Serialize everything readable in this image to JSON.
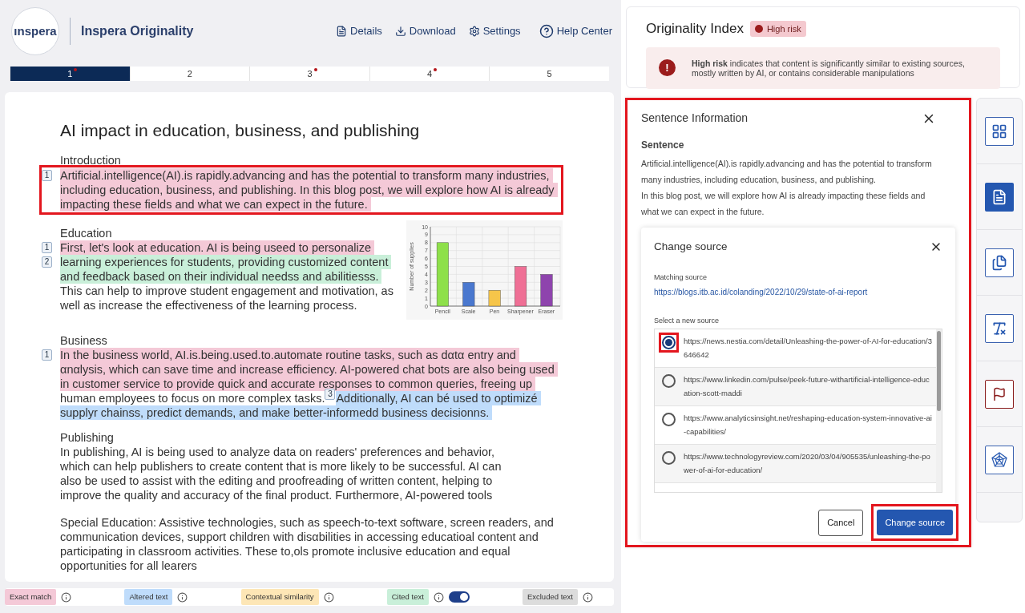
{
  "header": {
    "logo": "ınspera",
    "title": "Inspera Originality",
    "nav": [
      {
        "kind": "details",
        "label": "Details"
      },
      {
        "kind": "download",
        "label": "Download"
      },
      {
        "kind": "settings",
        "label": "Settings"
      },
      {
        "kind": "help",
        "label": "Help Center"
      }
    ]
  },
  "pages": [
    {
      "label": "1",
      "selected": true,
      "flagged": true
    },
    {
      "label": "2",
      "selected": false,
      "flagged": false
    },
    {
      "label": "3",
      "selected": false,
      "flagged": true
    },
    {
      "label": "4",
      "selected": false,
      "flagged": true
    },
    {
      "label": "5",
      "selected": false,
      "flagged": false
    }
  ],
  "document": {
    "title": "AI impact in education, business, and publishing",
    "sections": [
      {
        "heading": "Introduction",
        "highlighted": true,
        "lines": [
          {
            "marker": "1",
            "parts": [
              {
                "kind": "exact",
                "text": "Artificial.intelligence(AI).is rapidly.advancing and has the potential to transform many industries,"
              }
            ]
          },
          {
            "parts": [
              {
                "kind": "exact",
                "text": "including education, business, and publishing. In this blog post, we will explore how AI is already"
              }
            ]
          },
          {
            "parts": [
              {
                "kind": "exact",
                "text": "impacting these fields and what we can expect in the future."
              }
            ]
          }
        ]
      },
      {
        "heading": "Education",
        "highlighted": false,
        "lines": [
          {
            "marker": "1",
            "parts": [
              {
                "kind": "exact",
                "text": "First, let's look at education. AI is being useed to personalize"
              }
            ]
          },
          {
            "marker": "2",
            "parts": [
              {
                "kind": "cited",
                "text": "learning experiences for students, providing customized content"
              }
            ]
          },
          {
            "parts": [
              {
                "kind": "cited",
                "text": "and feedback based on their individual needss and abilitiesss."
              }
            ]
          },
          {
            "parts": [
              {
                "kind": "plain",
                "text": "This can help to improve student engagement and motivation, as"
              }
            ]
          },
          {
            "parts": [
              {
                "kind": "plain",
                "text": "well as increase the effectiveness of the learning process."
              }
            ]
          }
        ],
        "chart_data": {
          "type": "bar",
          "grid": true,
          "ylabel": "Number of supplies",
          "categories": [
            "Pencil",
            "Scale",
            "Pen",
            "Sharpener",
            "Eraser"
          ],
          "values": [
            8,
            3,
            2,
            5,
            4
          ],
          "ylim": [
            0,
            10
          ],
          "yticks": [
            {
              "value": 0,
              "label": "0"
            },
            {
              "value": 1,
              "label": "1"
            },
            {
              "value": 2,
              "label": "2"
            },
            {
              "value": 3,
              "label": "3"
            },
            {
              "value": 4,
              "label": "4"
            },
            {
              "value": 5,
              "label": "5"
            },
            {
              "value": 6,
              "label": "6"
            },
            {
              "value": 7,
              "label": "7"
            },
            {
              "value": 8,
              "label": "8"
            },
            {
              "value": 9,
              "label": "9"
            },
            {
              "value": 10,
              "label": "10"
            }
          ]
        }
      },
      {
        "heading": "Business",
        "highlighted": false,
        "lines": [
          {
            "marker": "1",
            "parts": [
              {
                "kind": "exact",
                "text": "In the business world, AI.is.being.used.to.automate routine tasks, such as dαtα entry and"
              }
            ]
          },
          {
            "parts": [
              {
                "kind": "exact",
                "text": "αnαlysis, which can save time and increase efficiency. AI-powered chat bots are also being used"
              }
            ]
          },
          {
            "parts": [
              {
                "kind": "exact",
                "text": "in customer service to provide quick and accurate responses to common queries, freeing up"
              }
            ]
          },
          {
            "parts": [
              {
                "kind": "plain",
                "text": "human employees to focus on more complex tasks."
              },
              {
                "kind": "marker",
                "text": "3"
              },
              {
                "kind": "altered",
                "text": "Additionally, AI can bé used to optimizé"
              }
            ]
          },
          {
            "parts": [
              {
                "kind": "altered",
                "text": "supplyr chainss, predict demands, and make better-informedd business decisionns."
              }
            ]
          }
        ]
      },
      {
        "heading": "Publishing",
        "highlighted": false,
        "lines": [
          {
            "parts": [
              {
                "kind": "plain",
                "text": "In publishing, AI is being used to analyze data on readers' preferences and behavior,"
              }
            ]
          },
          {
            "parts": [
              {
                "kind": "plain",
                "text": "which can help publishers to create content that is more likely to be successful. AI can"
              }
            ]
          },
          {
            "parts": [
              {
                "kind": "plain",
                "text": "also be used to assist with the editing and proofreading of written content, helping to"
              }
            ]
          },
          {
            "parts": [
              {
                "kind": "plain",
                "text": "improve the quality and accuracy of the final product. Furthermore, AI-powered tools"
              }
            ]
          }
        ]
      },
      {
        "highlighted": false,
        "lines": [
          {
            "parts": [
              {
                "kind": "plain",
                "text": "Special Education: Assistive technologies, such as speech-to-text software, screen readers, and"
              }
            ]
          },
          {
            "parts": [
              {
                "kind": "plain",
                "text": "communication devices, support children with disαbilities in accessing educatioal content and"
              }
            ]
          },
          {
            "parts": [
              {
                "kind": "plain",
                "text": "participating in classroom activities. These to,ols promote inclusive education and equal"
              }
            ]
          },
          {
            "parts": [
              {
                "kind": "plain",
                "text": "opportunities for all learers"
              }
            ]
          }
        ]
      }
    ]
  },
  "legend": [
    {
      "kind": "exact",
      "label": "Exact match"
    },
    {
      "kind": "altered",
      "label": "Altered text"
    },
    {
      "kind": "contextual",
      "label": "Contextual similarity"
    },
    {
      "kind": "cited",
      "label": "Cited text",
      "on": true
    },
    {
      "kind": "excluded",
      "label": "Excluded text"
    }
  ],
  "originality": {
    "title": "Originality Index",
    "risk": "High risk",
    "color": "#9b1c1c",
    "icon": "!",
    "notice": "**High risk** indicates that content is significantly similar to existing sources, mostly written by AI, or contains considerable manipulations"
  },
  "sentence_panel": {
    "title": "Sentence Information",
    "highlighted": true,
    "label": "Sentence",
    "lines": [
      "Artificial.intelligence(AI).is rapidly.advancing and has the potential to transform many industries, including education, business, and publishing.",
      "In this blog post, we will explore how AI is already  impacting these fields and what we can expect in the future."
    ]
  },
  "change_source": {
    "title": "Change source",
    "matching_label": "Matching source",
    "matching_url": "https://blogs.itb.ac.id/colanding/2022/10/29/state-of-ai-report",
    "select_label": "Select a new source",
    "sources": [
      {
        "url": "https://news.nestia.com/detail/Unleashing-the-power-of-AI-for-education/3646642",
        "selected": true
      },
      {
        "url": "https://www.linkedin.com/pulse/peek-future-withartificial-intelligence-education-scott-maddi",
        "selected": false
      },
      {
        "url": "https://www.analyticsinsight.net/reshaping-education-system-innovative-ai-capabilities/",
        "selected": false
      },
      {
        "url": "https://www.technologyreview.com/2020/03/04/905535/unleashing-the-power-of-ai-for-education/",
        "selected": false
      }
    ],
    "cancel": "Cancel",
    "confirm": "Change source",
    "confirm_highlighted": true
  },
  "toolbar": [
    {
      "kind": "grid",
      "selected": false
    },
    {
      "kind": "document",
      "selected": true
    },
    {
      "kind": "documents",
      "selected": false
    },
    {
      "kind": "text-format",
      "selected": false
    },
    {
      "kind": "flag",
      "selected": false
    },
    {
      "kind": "radar",
      "selected": false
    }
  ]
}
